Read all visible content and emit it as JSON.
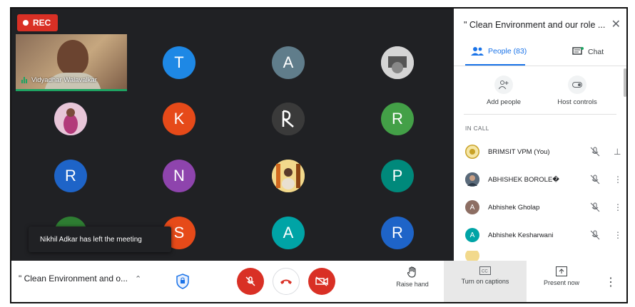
{
  "recording": {
    "label": "REC"
  },
  "self_tile": {
    "name": "Vidyadhar Walavalkar"
  },
  "tiles": [
    {
      "letter": "T",
      "color": "#1e88e5"
    },
    {
      "letter": "A",
      "color": "#607d8b"
    },
    {
      "letter": "",
      "color": "#e0e0e0"
    },
    {
      "letter": "",
      "color": "#7e57c2"
    },
    {
      "letter": "K",
      "color": "#e64a19"
    },
    {
      "letter": "",
      "color": "#424242"
    },
    {
      "letter": "R",
      "color": "#43a047"
    },
    {
      "letter": "R",
      "color": "#1e64c8"
    },
    {
      "letter": "N",
      "color": "#8e44ad"
    },
    {
      "letter": "",
      "color": "#f4c542"
    },
    {
      "letter": "P",
      "color": "#00897b"
    },
    {
      "letter": "S",
      "color": "#e64a19"
    },
    {
      "letter": "A",
      "color": "#00a4a6"
    },
    {
      "letter": "R",
      "color": "#1e64c8"
    }
  ],
  "toast": {
    "text": "Nikhil Adkar has left the meeting"
  },
  "bottom_bar": {
    "meeting_title": "\" Clean Environment and o...",
    "raise_hand": "Raise hand",
    "captions": "Turn on captions",
    "present": "Present now"
  },
  "panel": {
    "title": "\" Clean Environment and our role ...",
    "people_tab": "People (83)",
    "chat_tab": "Chat",
    "add_people": "Add people",
    "host_controls": "Host controls",
    "in_call": "IN CALL",
    "participants": [
      {
        "name": "BRIMSIT VPM (You)",
        "initial": "",
        "color": "#c9a227"
      },
      {
        "name": "ABHISHEK BOROLE�",
        "initial": "",
        "color": "#4a5a6a"
      },
      {
        "name": "Abhishek Gholap",
        "initial": "A",
        "color": "#8d6e63"
      },
      {
        "name": "Abhishek Kesharwani",
        "initial": "A",
        "color": "#00a4a6"
      }
    ]
  },
  "colors": {
    "accent": "#1a73e8",
    "danger": "#d93025",
    "bg": "#202124"
  }
}
